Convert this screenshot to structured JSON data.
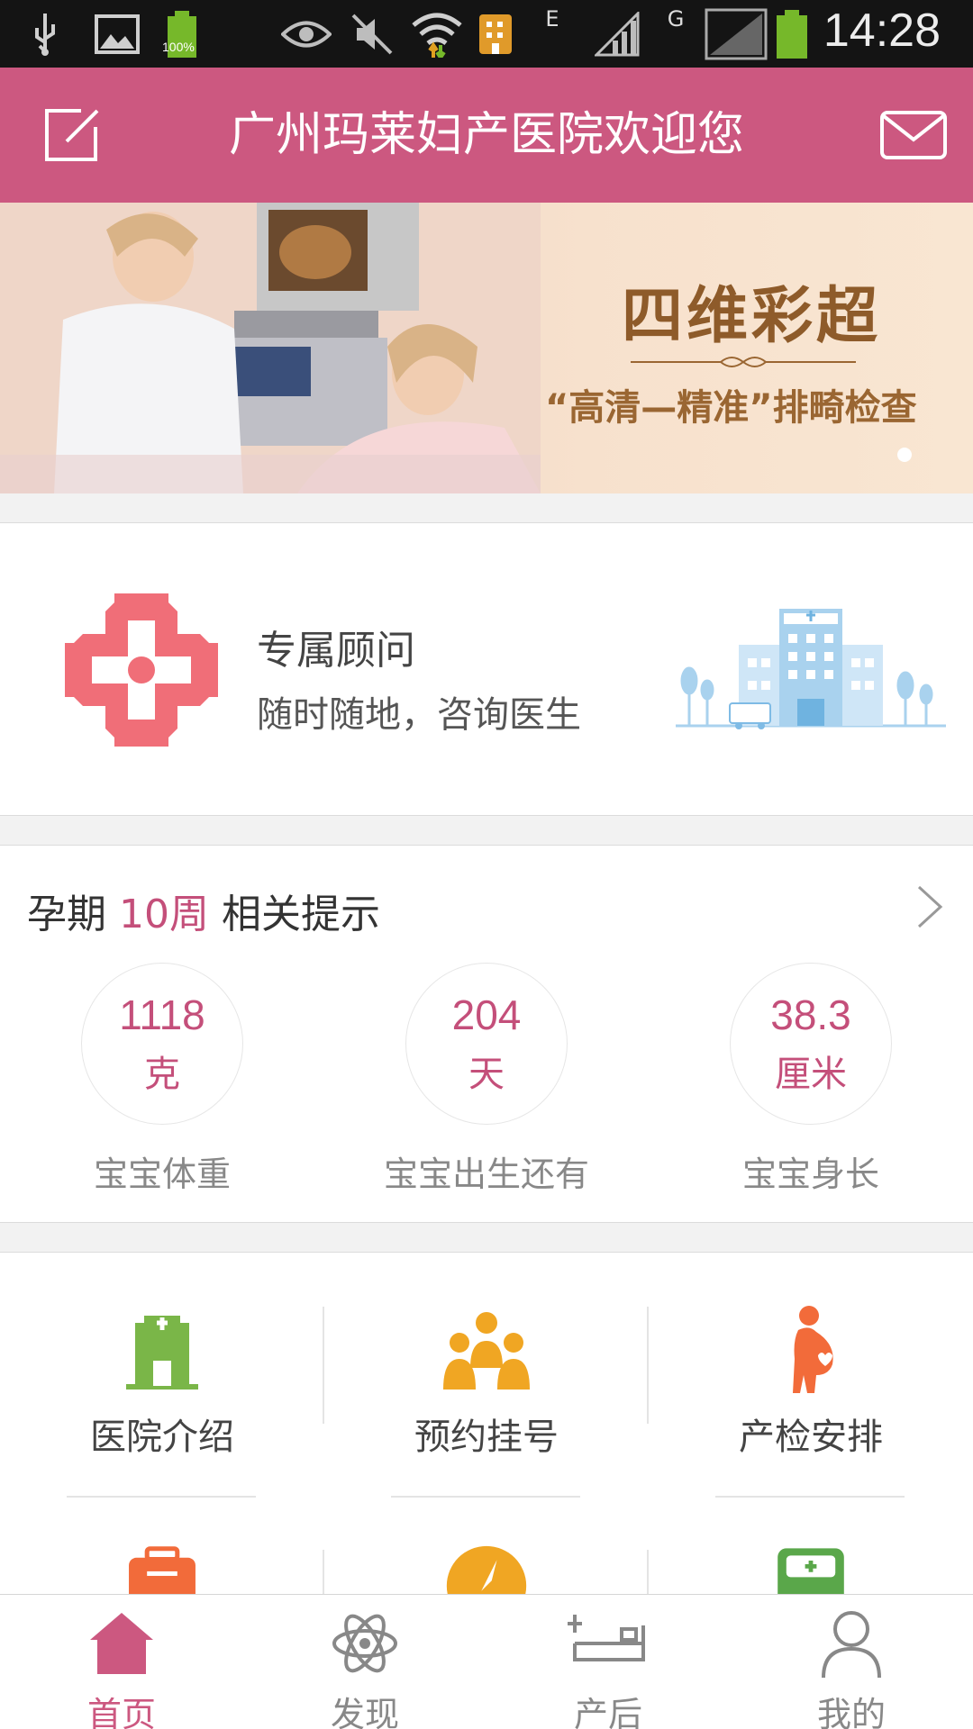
{
  "status_bar": {
    "time": "14:28",
    "battery_text": "100%",
    "network_e": "E",
    "network_g": "G"
  },
  "header": {
    "title": "广州玛莱妇产医院欢迎您"
  },
  "banner": {
    "title": "四维彩超",
    "subtitle": "“高清—精准”排畸检查"
  },
  "consultant": {
    "title": "专属顾问",
    "subtitle": "随时随地，咨询医生"
  },
  "pregnancy": {
    "prefix": "孕期",
    "weeks": "10周",
    "suffix": "相关提示",
    "stats": [
      {
        "value": "1118",
        "unit": "克",
        "label": "宝宝体重"
      },
      {
        "value": "204",
        "unit": "天",
        "label": "宝宝出生还有"
      },
      {
        "value": "38.3",
        "unit": "厘米",
        "label": "宝宝身长"
      }
    ]
  },
  "grid": {
    "items": [
      {
        "label": "医院介绍",
        "icon": "hospital-icon",
        "color": "#7ab648"
      },
      {
        "label": "预约挂号",
        "icon": "people-icon",
        "color": "#f0a623"
      },
      {
        "label": "产检安排",
        "icon": "pregnant-woman-icon",
        "color": "#f26b3a"
      }
    ]
  },
  "bottom_nav": {
    "items": [
      {
        "label": "首页",
        "icon": "home-icon",
        "active": true
      },
      {
        "label": "发现",
        "icon": "atom-icon",
        "active": false
      },
      {
        "label": "产后",
        "icon": "bed-icon",
        "active": false
      },
      {
        "label": "我的",
        "icon": "user-icon",
        "active": false
      }
    ]
  },
  "colors": {
    "brand": "#cc5880",
    "accent_text": "#c44f7a"
  }
}
